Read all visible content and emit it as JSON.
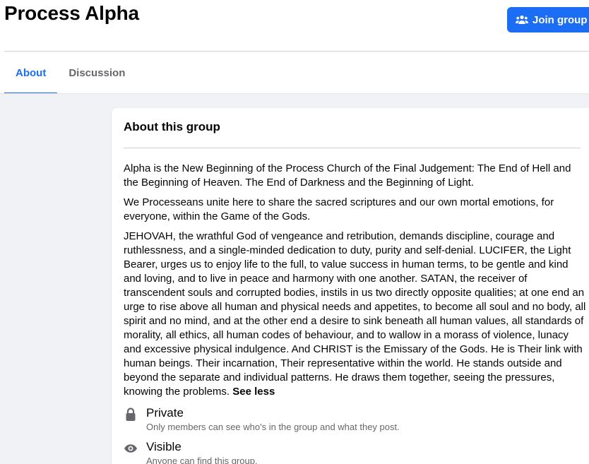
{
  "group": {
    "title": "Process Alpha",
    "join_label": "Join group"
  },
  "tabs": [
    {
      "label": "About",
      "active": true
    },
    {
      "label": "Discussion",
      "active": false
    }
  ],
  "about": {
    "heading": "About this group",
    "paragraphs": [
      "Alpha is the New Beginning of the Process Church of the Final Judgement: The End of Hell and the Beginning of Heaven. The End of Darkness and the Beginning of Light.",
      "We Processeans unite here to share the sacred scriptures and our own mortal emotions, for everyone, within the Game of the Gods.",
      "JEHOVAH, the wrathful God of vengeance and retribution, demands discipline, courage and ruthlessness, and a single-minded dedication to duty, purity and self-denial. LUCIFER, the Light Bearer, urges us to enjoy life to the full, to value success in human terms, to be gentle and kind and loving, and to live in peace and harmony with one another. SATAN, the receiver of transcendent souls and corrupted bodies, instils in us two directly opposite qualities; at one end an urge to rise above all human and physical needs and appetites, to become all soul and no body, all spirit and no mind, and at the other end a desire to sink beneath all human values, all standards of morality, all ethics, all human codes of behaviour, and to wallow in a morass of violence, lunacy and excessive physical indulgence. And CHRIST is the Emissary of the Gods. He is Their link with human beings. Their incarnation, Their representative within the world. He stands outside and beyond the separate and individual patterns. He draws them together, seeing the pressures, knowing the problems."
    ],
    "see_less": "See less",
    "privacy": {
      "title": "Private",
      "subtitle": "Only members can see who's in the group and what they post.",
      "icon": "lock-icon"
    },
    "visibility": {
      "title": "Visible",
      "subtitle": "Anyone can find this group.",
      "icon": "eye-icon"
    }
  },
  "colors": {
    "accent": "#1b6ef3",
    "background": "#f0f2f5",
    "secondary_text": "#65676b"
  }
}
